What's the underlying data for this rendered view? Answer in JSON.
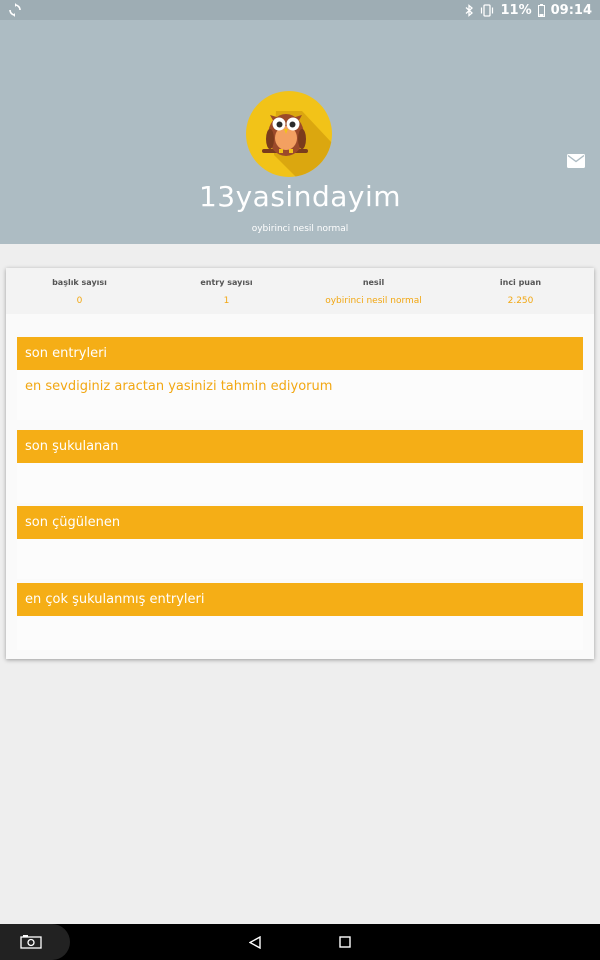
{
  "statusbar": {
    "battery": "11%",
    "time": "09:14"
  },
  "profile": {
    "username": "13yasindayim",
    "subtitle": "oybirinci nesil normal"
  },
  "stats": [
    {
      "label": "başlık sayısı",
      "value": "0"
    },
    {
      "label": "entry sayısı",
      "value": "1"
    },
    {
      "label": "nesil",
      "value": "oybirinci nesil normal"
    },
    {
      "label": "inci puan",
      "value": "2.250"
    }
  ],
  "sections": {
    "recent_entries": {
      "title": "son entryleri",
      "items": [
        "en sevdiginiz aractan yasinizi tahmin ediyorum"
      ]
    },
    "recent_liked": {
      "title": "son şukulanan"
    },
    "recent_disliked": {
      "title": "son çügülenen"
    },
    "most_liked": {
      "title": "en çok şukulanmış entryleri"
    }
  },
  "colors": {
    "accent": "#f5ae16",
    "header_bg": "#adbcc3",
    "avatar_bg": "#f2c318"
  },
  "icons": [
    "sync-icon",
    "bluetooth-icon",
    "vibrate-icon",
    "battery-icon",
    "mail-icon",
    "owl-avatar",
    "screenshot-icon",
    "back-icon",
    "recents-icon"
  ]
}
